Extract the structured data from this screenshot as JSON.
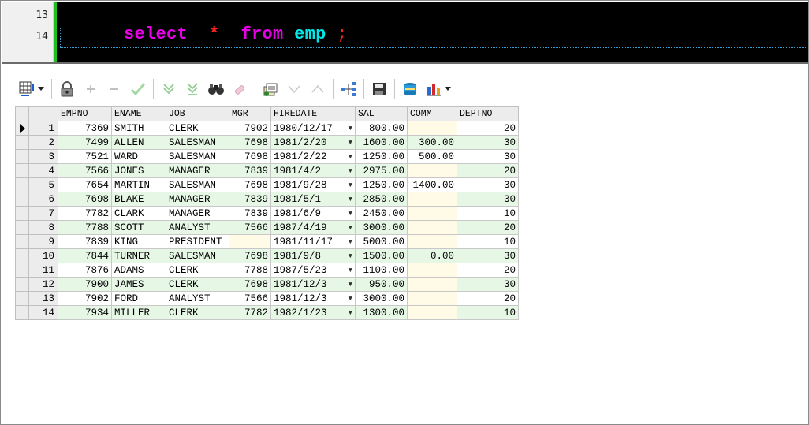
{
  "editor": {
    "lines": [
      {
        "number": "13",
        "tokens": [
          {
            "text": "select",
            "kind": "kw"
          },
          {
            "text": "  *  ",
            "kind": "op"
          },
          {
            "text": "from",
            "kind": "kw"
          },
          {
            "text": " ",
            "kind": "op"
          },
          {
            "text": "emp",
            "kind": "ident"
          },
          {
            "text": " ;",
            "kind": "semi"
          }
        ]
      },
      {
        "number": "14",
        "tokens": []
      }
    ]
  },
  "toolbar": {
    "icons": [
      "grid-options-icon",
      "lock-icon",
      "add-record-icon",
      "delete-record-icon",
      "post-changes-icon",
      "next-page-icon",
      "last-page-icon",
      "query-by-example-icon",
      "clear-icon",
      "export-icon",
      "previous-record-icon",
      "next-record-icon",
      "tree-view-icon",
      "save-icon",
      "print-icon",
      "chart-icon"
    ]
  },
  "grid": {
    "columns": [
      "EMPNO",
      "ENAME",
      "JOB",
      "MGR",
      "HIREDATE",
      "SAL",
      "COMM",
      "DEPTNO"
    ],
    "rows": [
      {
        "rn": "1",
        "empno": "7369",
        "ename": "SMITH",
        "job": "CLERK",
        "mgr": "7902",
        "hiredate": "1980/12/17",
        "sal": "800.00",
        "comm": "",
        "deptno": "20"
      },
      {
        "rn": "2",
        "empno": "7499",
        "ename": "ALLEN",
        "job": "SALESMAN",
        "mgr": "7698",
        "hiredate": "1981/2/20",
        "sal": "1600.00",
        "comm": "300.00",
        "deptno": "30"
      },
      {
        "rn": "3",
        "empno": "7521",
        "ename": "WARD",
        "job": "SALESMAN",
        "mgr": "7698",
        "hiredate": "1981/2/22",
        "sal": "1250.00",
        "comm": "500.00",
        "deptno": "30"
      },
      {
        "rn": "4",
        "empno": "7566",
        "ename": "JONES",
        "job": "MANAGER",
        "mgr": "7839",
        "hiredate": "1981/4/2",
        "sal": "2975.00",
        "comm": "",
        "deptno": "20"
      },
      {
        "rn": "5",
        "empno": "7654",
        "ename": "MARTIN",
        "job": "SALESMAN",
        "mgr": "7698",
        "hiredate": "1981/9/28",
        "sal": "1250.00",
        "comm": "1400.00",
        "deptno": "30"
      },
      {
        "rn": "6",
        "empno": "7698",
        "ename": "BLAKE",
        "job": "MANAGER",
        "mgr": "7839",
        "hiredate": "1981/5/1",
        "sal": "2850.00",
        "comm": "",
        "deptno": "30"
      },
      {
        "rn": "7",
        "empno": "7782",
        "ename": "CLARK",
        "job": "MANAGER",
        "mgr": "7839",
        "hiredate": "1981/6/9",
        "sal": "2450.00",
        "comm": "",
        "deptno": "10"
      },
      {
        "rn": "8",
        "empno": "7788",
        "ename": "SCOTT",
        "job": "ANALYST",
        "mgr": "7566",
        "hiredate": "1987/4/19",
        "sal": "3000.00",
        "comm": "",
        "deptno": "20"
      },
      {
        "rn": "9",
        "empno": "7839",
        "ename": "KING",
        "job": "PRESIDENT",
        "mgr": "",
        "hiredate": "1981/11/17",
        "sal": "5000.00",
        "comm": "",
        "deptno": "10"
      },
      {
        "rn": "10",
        "empno": "7844",
        "ename": "TURNER",
        "job": "SALESMAN",
        "mgr": "7698",
        "hiredate": "1981/9/8",
        "sal": "1500.00",
        "comm": "0.00",
        "deptno": "30"
      },
      {
        "rn": "11",
        "empno": "7876",
        "ename": "ADAMS",
        "job": "CLERK",
        "mgr": "7788",
        "hiredate": "1987/5/23",
        "sal": "1100.00",
        "comm": "",
        "deptno": "20"
      },
      {
        "rn": "12",
        "empno": "7900",
        "ename": "JAMES",
        "job": "CLERK",
        "mgr": "7698",
        "hiredate": "1981/12/3",
        "sal": "950.00",
        "comm": "",
        "deptno": "30"
      },
      {
        "rn": "13",
        "empno": "7902",
        "ename": "FORD",
        "job": "ANALYST",
        "mgr": "7566",
        "hiredate": "1981/12/3",
        "sal": "3000.00",
        "comm": "",
        "deptno": "20"
      },
      {
        "rn": "14",
        "empno": "7934",
        "ename": "MILLER",
        "job": "CLERK",
        "mgr": "7782",
        "hiredate": "1982/1/23",
        "sal": "1300.00",
        "comm": "",
        "deptno": "10"
      }
    ]
  },
  "colors": {
    "keyword": "#e800e8",
    "identifier": "#00e8e8",
    "operator": "#ff2020",
    "row_alt": "#e6f7e6",
    "null_cell": "#fffbe6"
  }
}
